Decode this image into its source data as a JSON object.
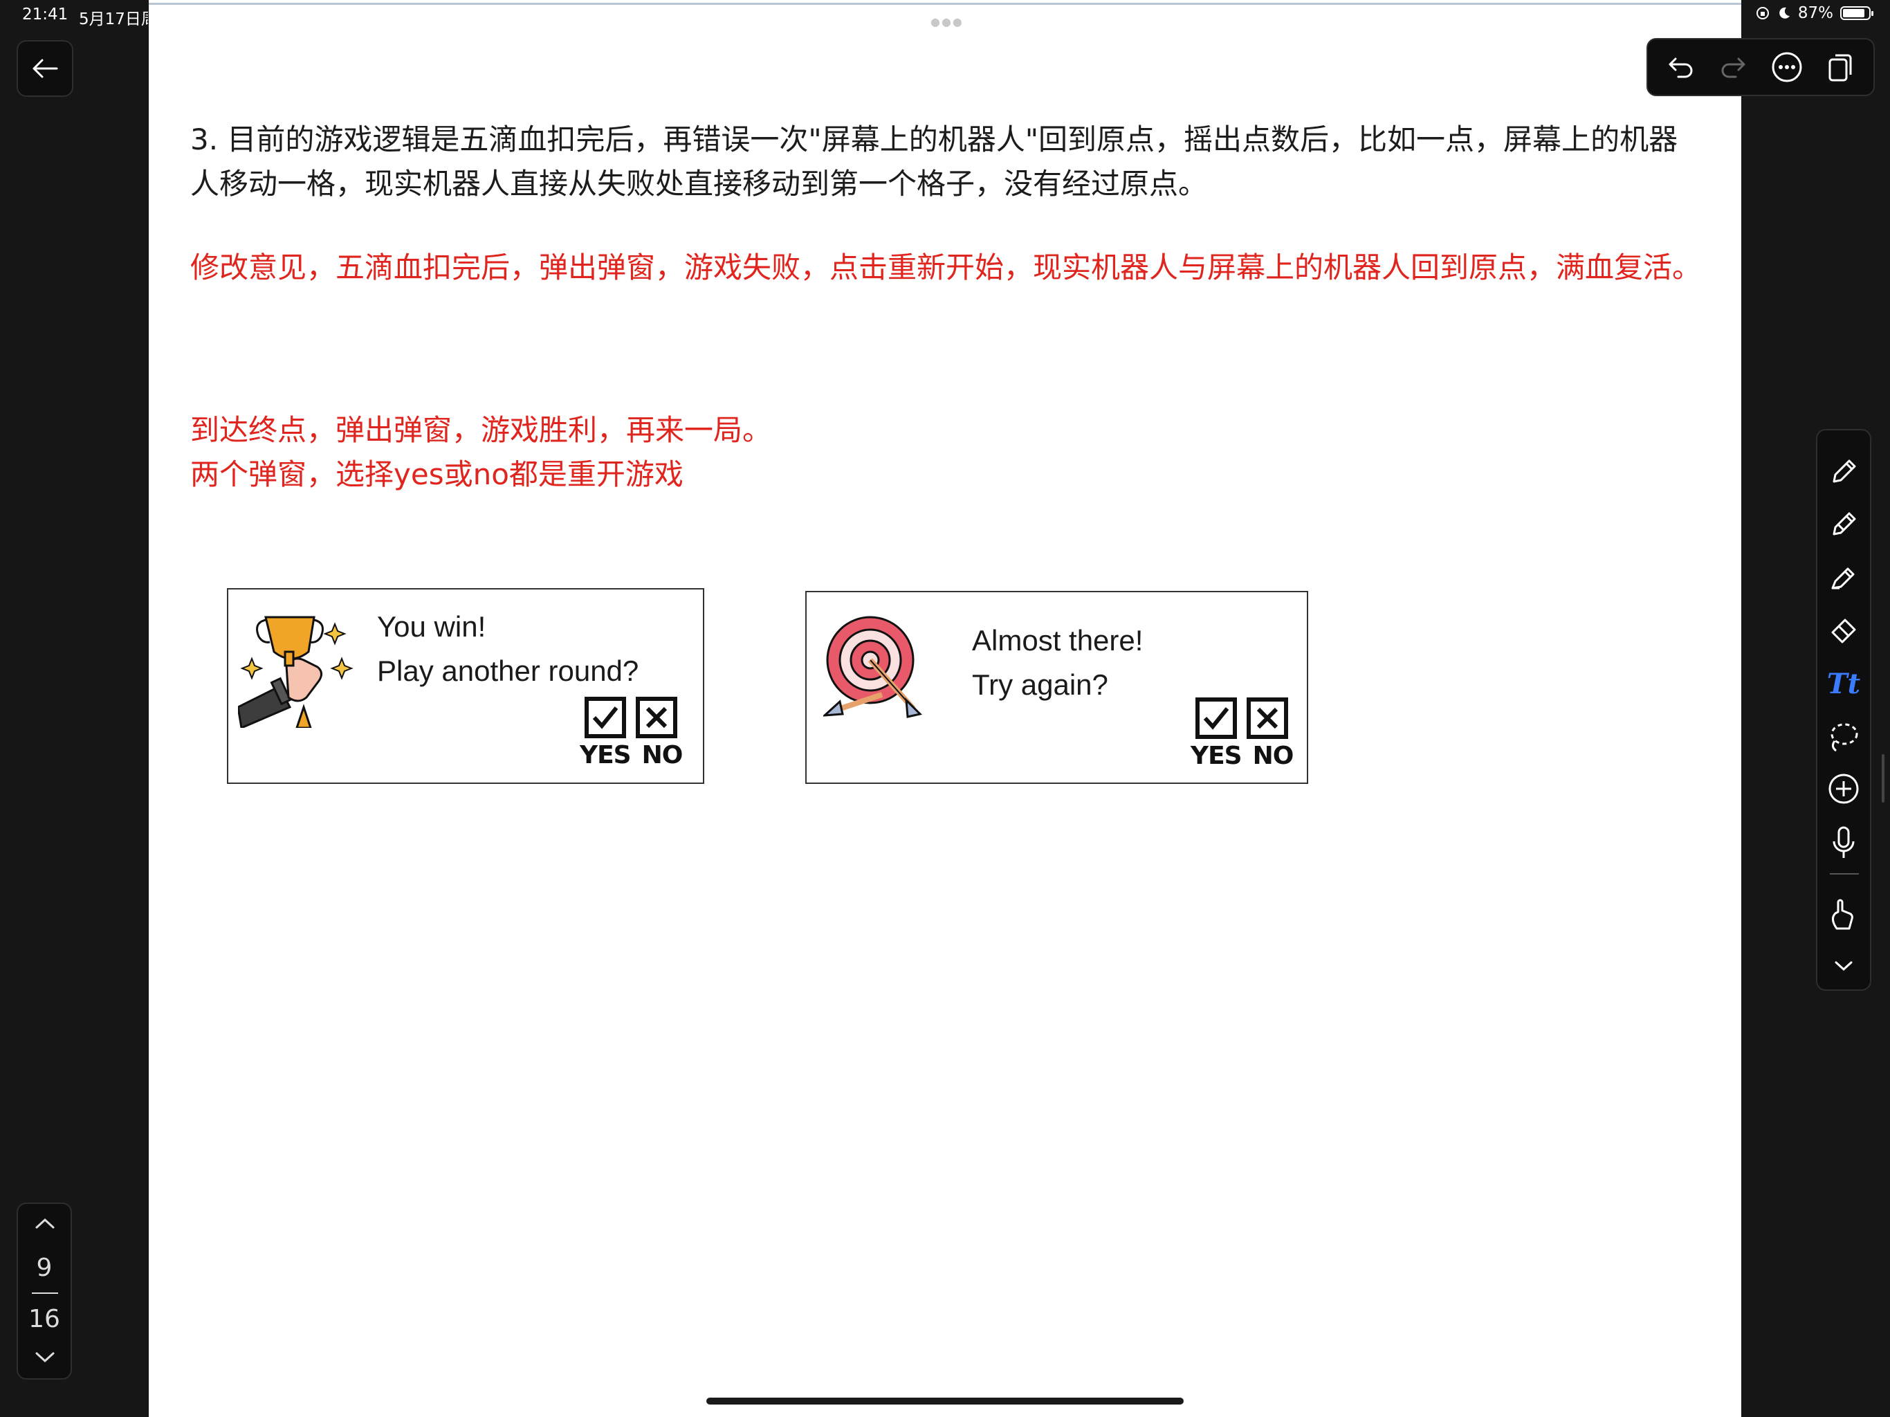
{
  "status": {
    "time": "21:41",
    "date": "5月17日周",
    "battery": "87%",
    "battery_level": 0.87
  },
  "content": {
    "para_black": "3. 目前的游戏逻辑是五滴血扣完后，再错误一次\"屏幕上的机器人\"回到原点，摇出点数后，比如一点，屏幕上的机器人移动一格，现实机器人直接从失败处直接移动到第一个格子，没有经过原点。",
    "para_red_1": "修改意见，五滴血扣完后，弹出弹窗，游戏失败，点击重新开始，现实机器人与屏幕上的机器人回到原点，满血复活。",
    "para_red_2_line1": "到达终点，弹出弹窗，游戏胜利，再来一局。",
    "para_red_2_line2": "两个弹窗，选择yes或no都是重开游戏"
  },
  "dialogs": {
    "win": {
      "line1": "You win!",
      "line2": "Play another round?",
      "yes": "YES",
      "no": "NO",
      "illustration": "trophy-icon"
    },
    "lose": {
      "line1": "Almost there!",
      "line2": "Try again?",
      "yes": "YES",
      "no": "NO",
      "illustration": "target-icon"
    }
  },
  "pager": {
    "current": "9",
    "total": "16"
  },
  "top_toolbar": [
    "undo-icon",
    "redo-icon",
    "more-icon",
    "pages-icon"
  ],
  "tools": [
    "pen-icon",
    "pencil-icon",
    "highlighter-icon",
    "eraser-icon",
    "text-tool-icon",
    "lasso-icon",
    "add-icon",
    "microphone-icon",
    "hand-icon",
    "chevron-down-icon"
  ],
  "tools_text_label": "Tt",
  "colors": {
    "red_text": "#e0241e",
    "accent_blue": "#3a7bff",
    "background": "#161616"
  }
}
